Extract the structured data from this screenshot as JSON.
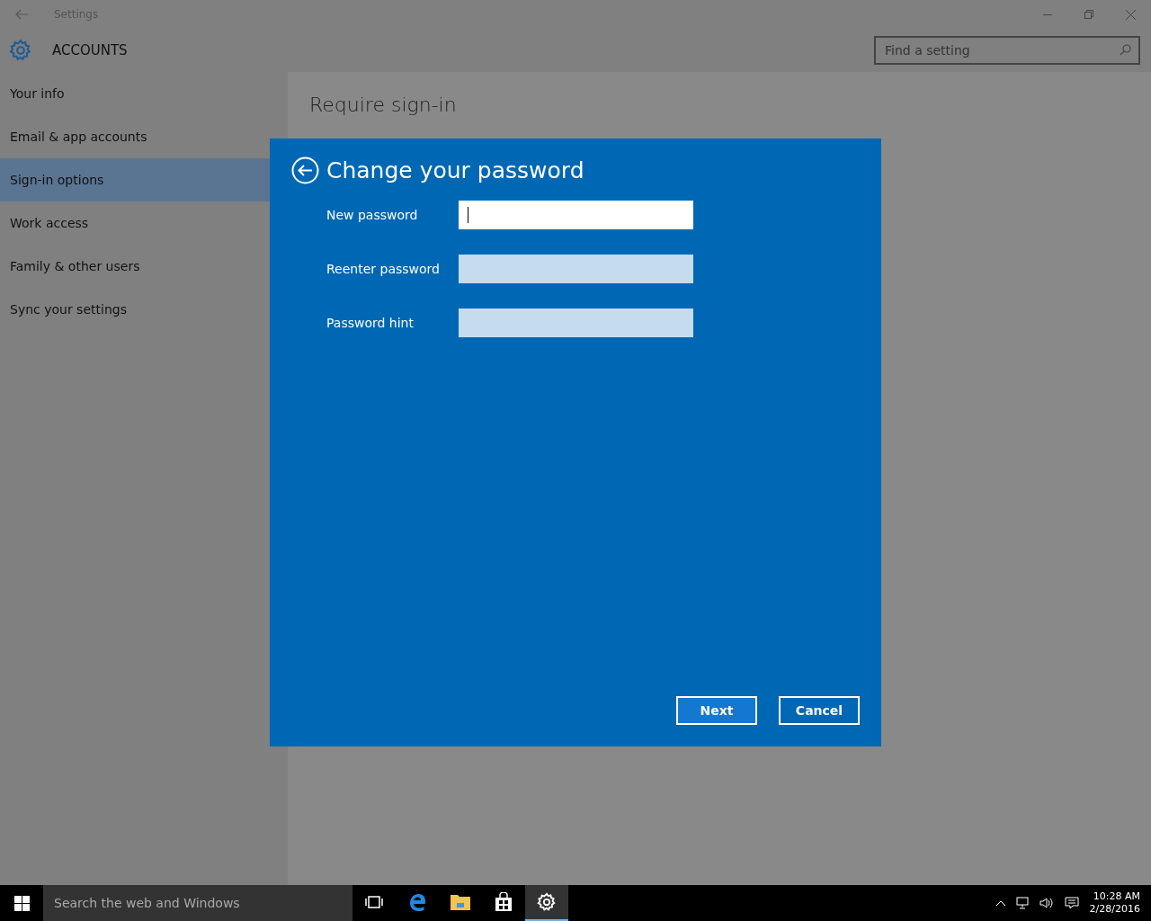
{
  "window": {
    "title": "Settings"
  },
  "header": {
    "title": "ACCOUNTS",
    "search": {
      "placeholder": "Find a setting"
    }
  },
  "sidebar": {
    "items": [
      {
        "label": "Your info",
        "selected": false
      },
      {
        "label": "Email & app accounts",
        "selected": false
      },
      {
        "label": "Sign-in options",
        "selected": true
      },
      {
        "label": "Work access",
        "selected": false
      },
      {
        "label": "Family & other users",
        "selected": false
      },
      {
        "label": "Sync your settings",
        "selected": false
      }
    ]
  },
  "content": {
    "heading": "Require sign-in"
  },
  "dialog": {
    "title": "Change your password",
    "fields": [
      {
        "label": "New password",
        "focused": true
      },
      {
        "label": "Reenter password",
        "focused": false
      },
      {
        "label": "Password hint",
        "focused": false
      }
    ],
    "buttons": [
      {
        "label": "Next",
        "default": true
      },
      {
        "label": "Cancel",
        "default": false
      }
    ]
  },
  "taskbar": {
    "search": {
      "placeholder": "Search the web and Windows"
    },
    "apps": [
      {
        "kind": "task-view",
        "selected": false
      },
      {
        "kind": "browser",
        "selected": false
      },
      {
        "kind": "folder",
        "selected": false
      },
      {
        "kind": "store",
        "selected": false
      },
      {
        "kind": "settings",
        "selected": true
      }
    ],
    "clock": {
      "time": "10:28 AM",
      "date": "2/28/2016"
    }
  }
}
